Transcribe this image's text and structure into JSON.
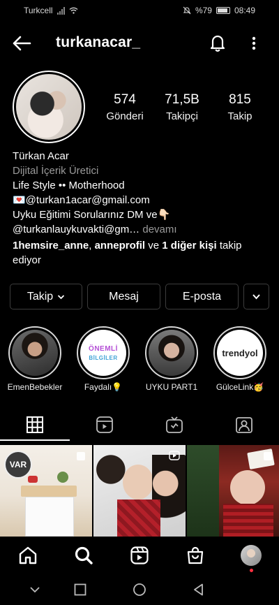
{
  "status_bar": {
    "carrier": "Turkcell",
    "battery": "%79",
    "time": "08:49"
  },
  "header": {
    "username": "turkanacar_"
  },
  "stats": [
    {
      "value": "574",
      "label": "Gönderi"
    },
    {
      "value": "71,5B",
      "label": "Takipçi"
    },
    {
      "value": "815",
      "label": "Takip"
    }
  ],
  "bio": {
    "name": "Türkan Acar",
    "category": "Dijital İçerik Üretici",
    "line1": "Life Style •• Motherhood",
    "line2": "💌@turkan1acar@gmail.com",
    "line3": "Uyku Eğitimi Sorularınız DM ve👇🏻",
    "line4": "@turkanlauykuvakti@gm…",
    "more": " devamı",
    "followed_by": {
      "user1": "1hemsire_anne",
      "sep1": ", ",
      "user2": "anneprofil",
      "sep2": " ve ",
      "others": "1 diğer kişi",
      "suffix": " takip ediyor"
    }
  },
  "buttons": {
    "follow": "Takip",
    "message": "Mesaj",
    "email": "E-posta"
  },
  "highlights": [
    {
      "label": "EmenBebekler"
    },
    {
      "label": "Faydalı💡",
      "title1": "ÖNEMLİ",
      "title2": "BİLGİLER"
    },
    {
      "label": "UYKU PART1"
    },
    {
      "label": "GülceLink🥳",
      "brand": "trendyol"
    }
  ],
  "grid": {
    "badge": "VAR"
  },
  "colors": {
    "background": "#000000",
    "border": "#3d3d3d",
    "notification": "#ff3040"
  }
}
